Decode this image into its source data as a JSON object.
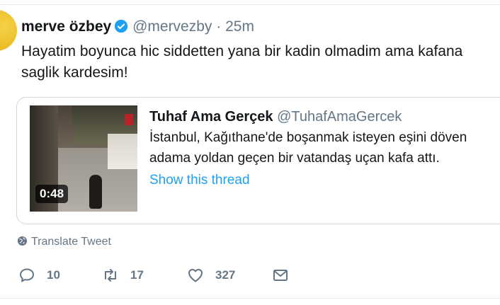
{
  "tweet": {
    "name": "merve özbey",
    "handle": "@mervezby",
    "separator": "·",
    "time": "25m",
    "text": "Hayatim boyunca hic siddetten yana bir kadin olmadim ama kafana saglik kardesim!"
  },
  "quote": {
    "name": "Tuhaf Ama Gerçek",
    "handle": "@TuhafAmaGercek",
    "text": "İstanbul, Kağıthane'de boşanmak isteyen eşini döven adama yoldan geçen bir vatandaş uçan kafa attı.",
    "show_thread": "Show this thread",
    "video_duration": "0:48"
  },
  "translate_label": "Translate Tweet",
  "actions": {
    "reply_count": "10",
    "retweet_count": "17",
    "like_count": "327"
  },
  "icons": {
    "verified": "verified-badge-icon",
    "globe": "globe-icon",
    "reply": "reply-icon",
    "retweet": "retweet-icon",
    "like": "heart-icon",
    "message": "envelope-icon"
  },
  "colors": {
    "accent": "#1da1f2",
    "text": "#14171a",
    "muted": "#657786",
    "border": "#ccd6dd"
  }
}
